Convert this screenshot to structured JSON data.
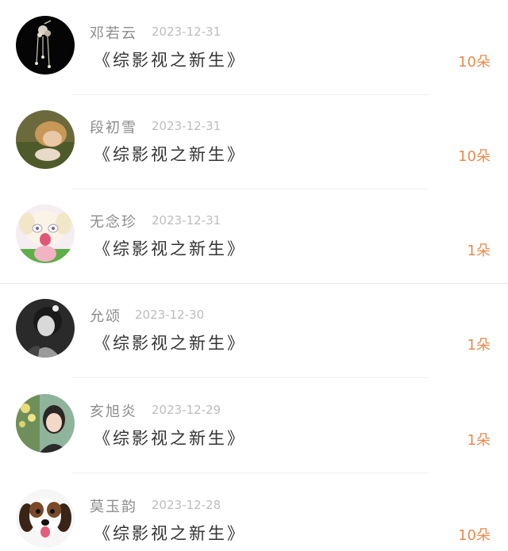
{
  "gifts": [
    {
      "name": "邓若云",
      "date": "2023-12-31",
      "title": "《综影视之新生》",
      "count": "10朵",
      "avatar_icon": "avatar-hairpin"
    },
    {
      "name": "段初雪",
      "date": "2023-12-31",
      "title": "《综影视之新生》",
      "count": "10朵",
      "avatar_icon": "avatar-girl-grass"
    },
    {
      "name": "无念珍",
      "date": "2023-12-31",
      "title": "《综影视之新生》",
      "count": "1朵",
      "avatar_icon": "avatar-anime"
    },
    {
      "name": "允颂",
      "date": "2023-12-30",
      "title": "《综影视之新生》",
      "count": "1朵",
      "avatar_icon": "avatar-bw-woman"
    },
    {
      "name": "亥旭炎",
      "date": "2023-12-29",
      "title": "《综影视之新生》",
      "count": "1朵",
      "avatar_icon": "avatar-girl-flowers"
    },
    {
      "name": "莫玉韵",
      "date": "2023-12-28",
      "title": "《综影视之新生》",
      "count": "10朵",
      "avatar_icon": "avatar-dog"
    }
  ],
  "colors": {
    "count": "#e88a4c",
    "name": "#8c8c8c",
    "date": "#bdbdbd",
    "title": "#333333"
  }
}
